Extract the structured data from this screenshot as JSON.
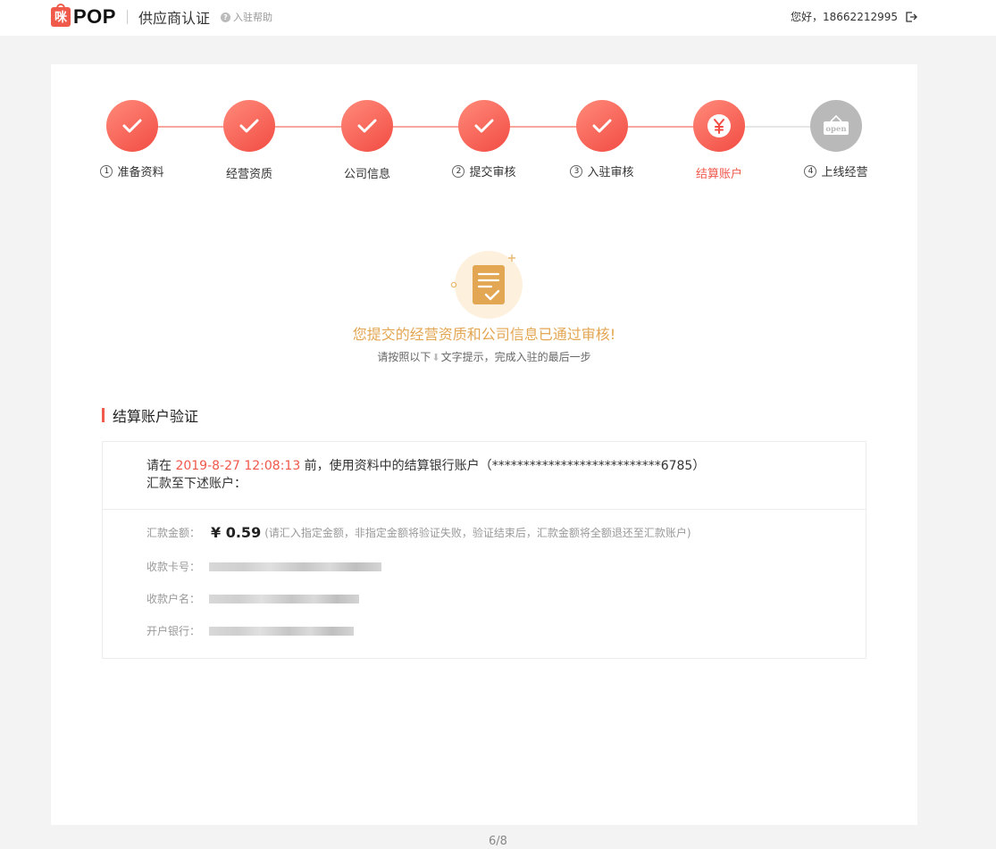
{
  "header": {
    "logo_mark": "咪",
    "logo_text": "POP",
    "portal_title": "供应商认证",
    "help_label": "入驻帮助",
    "greeting": "您好，18662212995"
  },
  "steps": [
    {
      "num": "1",
      "label": "准备资料",
      "status": "done"
    },
    {
      "num": "",
      "label": "经营资质",
      "status": "done"
    },
    {
      "num": "",
      "label": "公司信息",
      "status": "done"
    },
    {
      "num": "2",
      "label": "提交审核",
      "status": "done"
    },
    {
      "num": "3",
      "label": "入驻审核",
      "status": "done"
    },
    {
      "num": "",
      "label": "结算账户",
      "status": "active"
    },
    {
      "num": "4",
      "label": "上线经营",
      "status": "pending"
    }
  ],
  "notice": {
    "title": "您提交的经营资质和公司信息已通过审核!",
    "sub_before": "请按照以下",
    "sub_after": "文字提示，完成入驻的最后一步"
  },
  "section": {
    "title": "结算账户验证"
  },
  "verification": {
    "line1_prefix": "请在 ",
    "deadline": "2019-8-27 12:08:13",
    "line1_middle": " 前，使用资料中的结算银行账户（",
    "masked_account": "***************************6785",
    "line1_suffix": "）",
    "line2": "汇款至下述账户：",
    "amount_label": "汇款金额：",
    "amount": "¥ 0.59",
    "amount_note": "(请汇入指定金额，非指定金额将验证失败，验证结束后，汇款金额将全额退还至汇款账户)",
    "card_label": "收款卡号：",
    "name_label": "收款户名：",
    "bank_label": "开户银行："
  },
  "pager": "6/8",
  "colors": {
    "accent": "#f05a4a",
    "notice": "#e3a652",
    "pending": "#b9b9b9"
  }
}
